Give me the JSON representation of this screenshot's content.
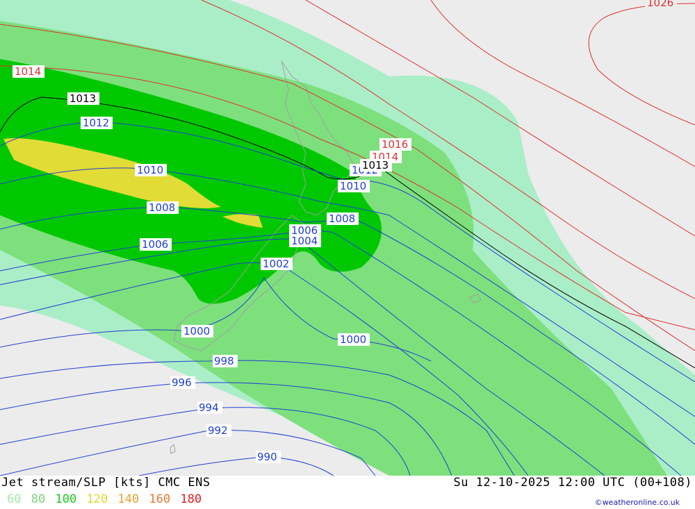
{
  "title": "Jet stream/SLP [kts] CMC ENS",
  "datetime": "Su 12-10-2025 12:00 UTC (00+108)",
  "credit": "©weatheronline.co.uk",
  "legend": [
    {
      "label": "60",
      "color": "#a8e8a8"
    },
    {
      "label": "80",
      "color": "#7cd67c"
    },
    {
      "label": "100",
      "color": "#1ec81e"
    },
    {
      "label": "120",
      "color": "#e0d830"
    },
    {
      "label": "140",
      "color": "#e8a030"
    },
    {
      "label": "160",
      "color": "#e87830"
    },
    {
      "label": "180",
      "color": "#e02020"
    }
  ],
  "isobar_labels": {
    "l1026": "1026",
    "l1016": "1016",
    "l1014a": "1014",
    "l1014b": "1014",
    "l1013a": "1013",
    "l1013b": "1013",
    "l1012a": "1012",
    "l1012b": "1012",
    "l1010a": "1010",
    "l1010b": "1010",
    "l1008a": "1008",
    "l1008b": "1008",
    "l1006a": "1006",
    "l1006b": "1006",
    "l1004": "1004",
    "l1002": "1002",
    "l1000a": "1000",
    "l1000b": "1000",
    "l998": "998",
    "l996": "996",
    "l994": "994",
    "l992": "992",
    "l990": "990"
  },
  "colors": {
    "background": "#ececec",
    "high_isobar": "#e03030",
    "low_isobar": "#2040d0",
    "ref_isobar": "#000000",
    "coast": "#a0a0a0"
  }
}
